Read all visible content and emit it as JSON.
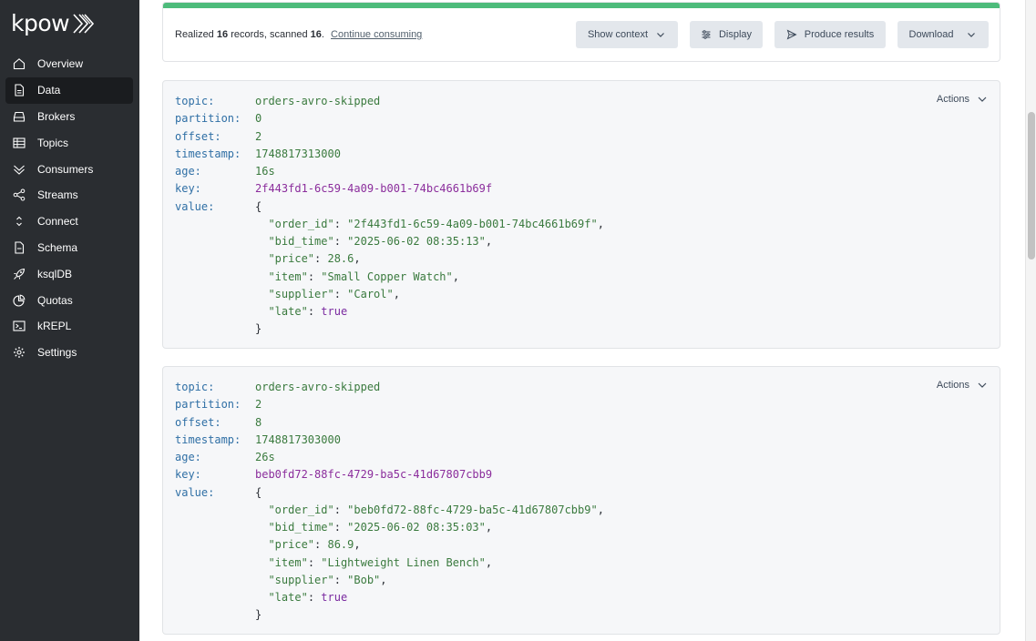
{
  "app": {
    "logo_text": "kpow"
  },
  "sidebar": {
    "items": [
      {
        "label": "Overview",
        "icon": "home-icon",
        "active": false
      },
      {
        "label": "Data",
        "icon": "document-icon",
        "active": true
      },
      {
        "label": "Brokers",
        "icon": "broker-icon",
        "active": false
      },
      {
        "label": "Topics",
        "icon": "topics-table-icon",
        "active": false
      },
      {
        "label": "Consumers",
        "icon": "consumers-chevron-icon",
        "active": false
      },
      {
        "label": "Streams",
        "icon": "share-nodes-icon",
        "active": false
      },
      {
        "label": "Connect",
        "icon": "connect-arrows-icon",
        "active": false
      },
      {
        "label": "Schema",
        "icon": "schema-document-icon",
        "active": false
      },
      {
        "label": "ksqlDB",
        "icon": "rocket-icon",
        "active": false
      },
      {
        "label": "Quotas",
        "icon": "pie-chart-icon",
        "active": false
      },
      {
        "label": "kREPL",
        "icon": "terminal-icon",
        "active": false
      },
      {
        "label": "Settings",
        "icon": "gear-icon",
        "active": false
      }
    ]
  },
  "summary": {
    "prefix": "Realized",
    "realized_count": "16",
    "middle": "records, scanned",
    "scanned_count": "16",
    "suffix": ".",
    "continue_label": "Continue consuming",
    "progress_fraction": 1.0,
    "buttons": {
      "show_context": "Show context",
      "display": "Display",
      "produce_results": "Produce results",
      "download": "Download"
    }
  },
  "labels": {
    "topic": "topic:",
    "partition": "partition:",
    "offset": "offset:",
    "timestamp": "timestamp:",
    "age": "age:",
    "key": "key:",
    "value": "value:",
    "actions": "Actions"
  },
  "records": [
    {
      "topic": "orders-avro-skipped",
      "partition": "0",
      "offset": "2",
      "timestamp": "1748817313000",
      "age": "16s",
      "key": "2f443fd1-6c59-4a09-b001-74bc4661b69f",
      "value": [
        {
          "k": "\"order_id\"",
          "v": "\"2f443fd1-6c59-4a09-b001-74bc4661b69f\"",
          "type": "string"
        },
        {
          "k": "\"bid_time\"",
          "v": "\"2025-06-02 08:35:13\"",
          "type": "string"
        },
        {
          "k": "\"price\"",
          "v": "28.6",
          "type": "number"
        },
        {
          "k": "\"item\"",
          "v": "\"Small Copper Watch\"",
          "type": "string"
        },
        {
          "k": "\"supplier\"",
          "v": "\"Carol\"",
          "type": "string"
        },
        {
          "k": "\"late\"",
          "v": "true",
          "type": "bool"
        }
      ]
    },
    {
      "topic": "orders-avro-skipped",
      "partition": "2",
      "offset": "8",
      "timestamp": "1748817303000",
      "age": "26s",
      "key": "beb0fd72-88fc-4729-ba5c-41d67807cbb9",
      "value": [
        {
          "k": "\"order_id\"",
          "v": "\"beb0fd72-88fc-4729-ba5c-41d67807cbb9\"",
          "type": "string"
        },
        {
          "k": "\"bid_time\"",
          "v": "\"2025-06-02 08:35:03\"",
          "type": "string"
        },
        {
          "k": "\"price\"",
          "v": "86.9",
          "type": "number"
        },
        {
          "k": "\"item\"",
          "v": "\"Lightweight Linen Bench\"",
          "type": "string"
        },
        {
          "k": "\"supplier\"",
          "v": "\"Bob\"",
          "type": "string"
        },
        {
          "k": "\"late\"",
          "v": "true",
          "type": "bool"
        }
      ]
    }
  ],
  "colors": {
    "sidebar_bg": "#2a2d31",
    "progress": "#4dbb7b",
    "label_key": "#2f6fa5",
    "value_text": "#3a7a3e",
    "record_key": "#8b2d9c"
  }
}
